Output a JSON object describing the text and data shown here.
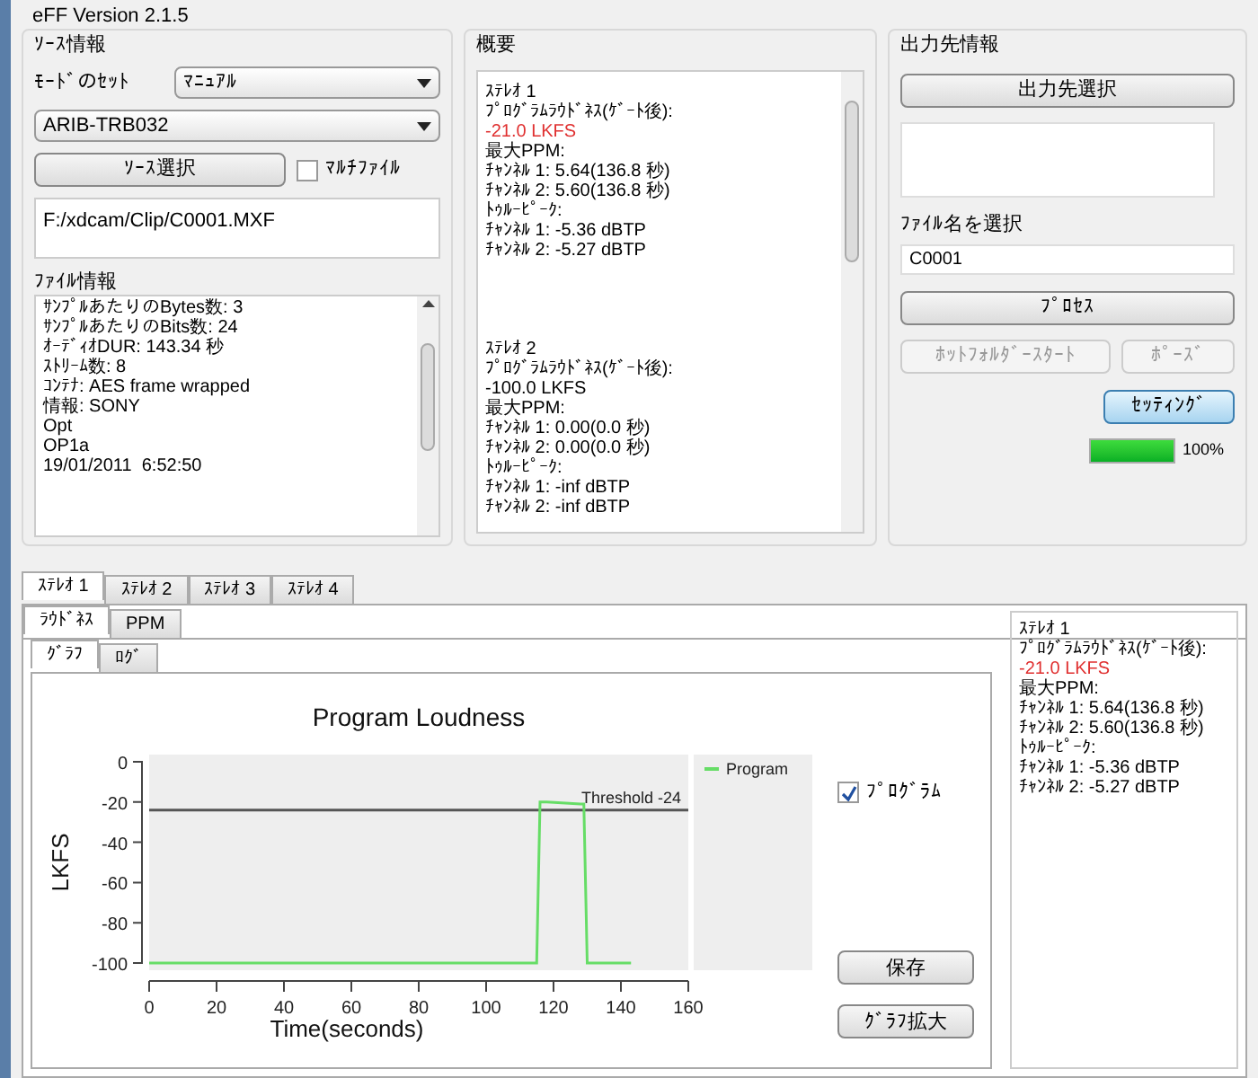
{
  "window": {
    "title": "eFF Version 2.1.5"
  },
  "source": {
    "title": "ｿｰｽ情報",
    "mode_label": "ﾓｰﾄﾞのｾｯﾄ",
    "mode_value": "ﾏﾆｭｱﾙ",
    "standard_value": "ARIB-TRB032",
    "select_button": "ｿｰｽ選択",
    "multi_file": {
      "label": "ﾏﾙﾁﾌｧｲﾙ",
      "checked": false
    },
    "path": "F:/xdcam/Clip/C0001.MXF",
    "file_info_label": "ﾌｧｲﾙ情報",
    "file_info": [
      "ｻﾝﾌﾟﾙあたりのBytes数: 3",
      "ｻﾝﾌﾟﾙあたりのBits数: 24",
      "ｵｰﾃﾞｨｵDUR: 143.34 秒",
      "ｽﾄﾘｰﾑ数: 8",
      "ｺﾝﾃﾅ: AES frame wrapped",
      "情報: SONY",
      "Opt",
      "OP1a",
      "19/01/2011  6:52:50"
    ]
  },
  "summary": {
    "title": "概要",
    "groups": [
      {
        "lines": [
          {
            "text": "ｽﾃﾚｵ 1",
            "alert": false
          },
          {
            "text": "ﾌﾟﾛｸﾞﾗﾑﾗｳﾄﾞﾈｽ(ｹﾞｰﾄ後):",
            "alert": false
          },
          {
            "text": "-21.0 LKFS",
            "alert": true
          },
          {
            "text": "最大PPM:",
            "alert": false
          },
          {
            "text": "ﾁｬﾝﾈﾙ 1: 5.64(136.8 秒)",
            "alert": false
          },
          {
            "text": "ﾁｬﾝﾈﾙ 2: 5.60(136.8 秒)",
            "alert": false
          },
          {
            "text": "ﾄｩﾙｰﾋﾟｰｸ:",
            "alert": false
          },
          {
            "text": "ﾁｬﾝﾈﾙ 1: -5.36 dBTP",
            "alert": false
          },
          {
            "text": "ﾁｬﾝﾈﾙ 2: -5.27 dBTP",
            "alert": false
          }
        ]
      },
      {
        "lines": [
          {
            "text": "ｽﾃﾚｵ 2",
            "alert": false
          },
          {
            "text": "ﾌﾟﾛｸﾞﾗﾑﾗｳﾄﾞﾈｽ(ｹﾞｰﾄ後):",
            "alert": false
          },
          {
            "text": "-100.0 LKFS",
            "alert": false
          },
          {
            "text": "最大PPM:",
            "alert": false
          },
          {
            "text": "ﾁｬﾝﾈﾙ 1: 0.00(0.0 秒)",
            "alert": false
          },
          {
            "text": "ﾁｬﾝﾈﾙ 2: 0.00(0.0 秒)",
            "alert": false
          },
          {
            "text": "ﾄｩﾙｰﾋﾟｰｸ:",
            "alert": false
          },
          {
            "text": "ﾁｬﾝﾈﾙ 1: -inf dBTP",
            "alert": false
          },
          {
            "text": "ﾁｬﾝﾈﾙ 2: -inf dBTP",
            "alert": false
          }
        ]
      }
    ]
  },
  "output": {
    "title": "出力先情報",
    "select_button": "出力先選択",
    "filename_label": "ﾌｧｲﾙ名を選択",
    "filename": "C0001",
    "process_button": "ﾌﾟﾛｾｽ",
    "hotfolder_button": {
      "label": "ﾎｯﾄﾌｫﾙﾀﾞｰｽﾀｰﾄ",
      "disabled": true
    },
    "pause_button": {
      "label": "ﾎﾟｰｽﾞ",
      "disabled": true
    },
    "settings_button": "ｾｯﾃｨﾝｸﾞ",
    "progress": {
      "level": 1,
      "reading": "100%"
    }
  },
  "stereo_tabs": [
    {
      "label": "ｽﾃﾚｵ 1",
      "selected": true
    },
    {
      "label": "ｽﾃﾚｵ 2",
      "selected": false
    },
    {
      "label": "ｽﾃﾚｵ 3",
      "selected": false
    },
    {
      "label": "ｽﾃﾚｵ 4",
      "selected": false
    }
  ],
  "measure_tabs": [
    {
      "label": "ﾗｳﾄﾞﾈｽ",
      "selected": true
    },
    {
      "label": "PPM",
      "selected": false
    }
  ],
  "view_tabs": [
    {
      "label": "ｸﾞﾗﾌ",
      "selected": true
    },
    {
      "label": "ﾛｸﾞ",
      "selected": false
    }
  ],
  "graph": {
    "chart_data": {
      "type": "line",
      "title": "Program Loudness",
      "xlabel": "Time(seconds)",
      "ylabel": "LKFS",
      "x": [
        0,
        115,
        116,
        118,
        128,
        129,
        130,
        143
      ],
      "series": [
        {
          "name": "Program",
          "color": "#66dd66",
          "values": [
            -100,
            -100,
            -20,
            -20,
            -21,
            -21,
            -100,
            -100
          ]
        }
      ],
      "xlim": [
        0,
        160
      ],
      "ylim": [
        -100,
        0
      ],
      "xticks": [
        0,
        20,
        40,
        60,
        80,
        100,
        120,
        140,
        160
      ],
      "yticks": [
        0,
        -20,
        -40,
        -60,
        -80,
        -100
      ],
      "ref_lines": [
        {
          "axis": "y",
          "value": -24,
          "label": "Threshold -24"
        }
      ]
    },
    "program_checkbox": {
      "label": "ﾌﾟﾛｸﾞﾗﾑ",
      "checked": true
    },
    "save_button": "保存",
    "zoom_button": "ｸﾞﾗﾌ拡大"
  },
  "side_summary": [
    {
      "text": "ｽﾃﾚｵ 1",
      "alert": false
    },
    {
      "text": "ﾌﾟﾛｸﾞﾗﾑﾗｳﾄﾞﾈｽ(ｹﾞｰﾄ後):",
      "alert": false
    },
    {
      "text": "-21.0 LKFS",
      "alert": true
    },
    {
      "text": "最大PPM:",
      "alert": false
    },
    {
      "text": "ﾁｬﾝﾈﾙ 1: 5.64(136.8 秒)",
      "alert": false
    },
    {
      "text": "ﾁｬﾝﾈﾙ 2: 5.60(136.8 秒)",
      "alert": false
    },
    {
      "text": "ﾄｩﾙｰﾋﾟｰｸ:",
      "alert": false
    },
    {
      "text": "ﾁｬﾝﾈﾙ 1: -5.36 dBTP",
      "alert": false
    },
    {
      "text": "ﾁｬﾝﾈﾙ 2: -5.27 dBTP",
      "alert": false
    }
  ]
}
